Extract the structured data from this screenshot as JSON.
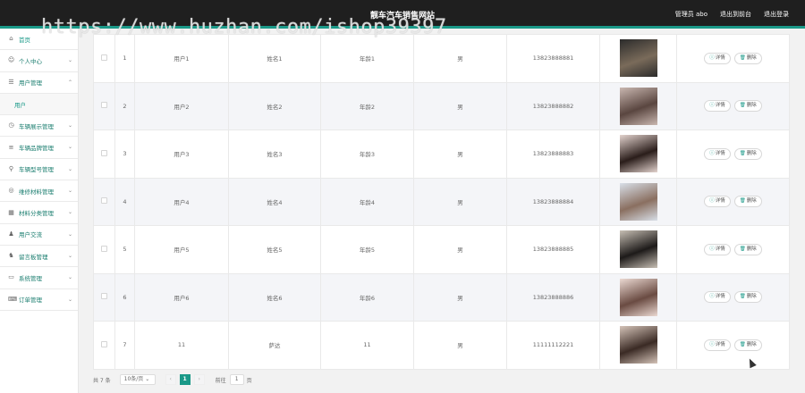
{
  "header": {
    "title": "靓车汽车销售网站",
    "admin_label": "管理员 abo",
    "back_label": "退出到前台",
    "logout_label": "退出登录"
  },
  "watermark": "https://www.huzhan.com/ishop39397",
  "sidebar": {
    "items": [
      {
        "label": "首页",
        "icon": "home-icon",
        "chev": ""
      },
      {
        "label": "个人中心",
        "icon": "user-icon",
        "chev": "⌄"
      },
      {
        "label": "用户管理",
        "icon": "list-icon",
        "chev": "⌃"
      },
      {
        "label": "用户",
        "icon": "",
        "chev": "",
        "sub": true
      },
      {
        "label": "车辆展示管理",
        "icon": "clock-icon",
        "chev": "⌄"
      },
      {
        "label": "车辆品牌管理",
        "icon": "sliders-icon",
        "chev": "⌄"
      },
      {
        "label": "车辆型号管理",
        "icon": "pin-icon",
        "chev": "⌄"
      },
      {
        "label": "维修材料管理",
        "icon": "life-ring-icon",
        "chev": "⌄"
      },
      {
        "label": "材料分类管理",
        "icon": "grid-icon",
        "chev": "⌄"
      },
      {
        "label": "用户交流",
        "icon": "person-icon",
        "chev": "⌄"
      },
      {
        "label": "留言板管理",
        "icon": "users-icon",
        "chev": "⌄"
      },
      {
        "label": "系统管理",
        "icon": "monitor-icon",
        "chev": "⌄"
      },
      {
        "label": "订单管理",
        "icon": "keyboard-icon",
        "chev": "⌄"
      }
    ]
  },
  "table": {
    "rows": [
      {
        "index": "1",
        "account": "用户1",
        "name": "姓名1",
        "age": "年龄1",
        "gender": "男",
        "phone": "13823888881",
        "photo_colors": [
          "#2b2b2b",
          "#7a6b5a"
        ]
      },
      {
        "index": "2",
        "account": "用户2",
        "name": "姓名2",
        "age": "年龄2",
        "gender": "男",
        "phone": "13823888882",
        "photo_colors": [
          "#c9b7b0",
          "#5a4640"
        ]
      },
      {
        "index": "3",
        "account": "用户3",
        "name": "姓名3",
        "age": "年龄3",
        "gender": "男",
        "phone": "13823888883",
        "photo_colors": [
          "#e3d3ce",
          "#2a1d1a"
        ]
      },
      {
        "index": "4",
        "account": "用户4",
        "name": "姓名4",
        "age": "年龄4",
        "gender": "男",
        "phone": "13823888884",
        "photo_colors": [
          "#d8dfe8",
          "#8a6f60"
        ]
      },
      {
        "index": "5",
        "account": "用户5",
        "name": "姓名5",
        "age": "年龄5",
        "gender": "男",
        "phone": "13823888885",
        "photo_colors": [
          "#c7bfb4",
          "#1d1a19"
        ]
      },
      {
        "index": "6",
        "account": "用户6",
        "name": "姓名6",
        "age": "年龄6",
        "gender": "男",
        "phone": "13823888886",
        "photo_colors": [
          "#ebd9d2",
          "#6a4b42"
        ]
      },
      {
        "index": "7",
        "account": "11",
        "name": "萨达",
        "age": "11",
        "gender": "男",
        "phone": "11111112221",
        "photo_colors": [
          "#d4c3b8",
          "#3a2a24"
        ]
      }
    ],
    "detail_label": "详情",
    "delete_label": "删除"
  },
  "pager": {
    "total": "共 7 条",
    "page_size": "10条/页",
    "current_page": "1",
    "goto_label": "前往",
    "goto_value": "1",
    "page_suffix": "页"
  },
  "colors": {
    "accent": "#1a9988",
    "topbar": "#1f1f1f"
  }
}
